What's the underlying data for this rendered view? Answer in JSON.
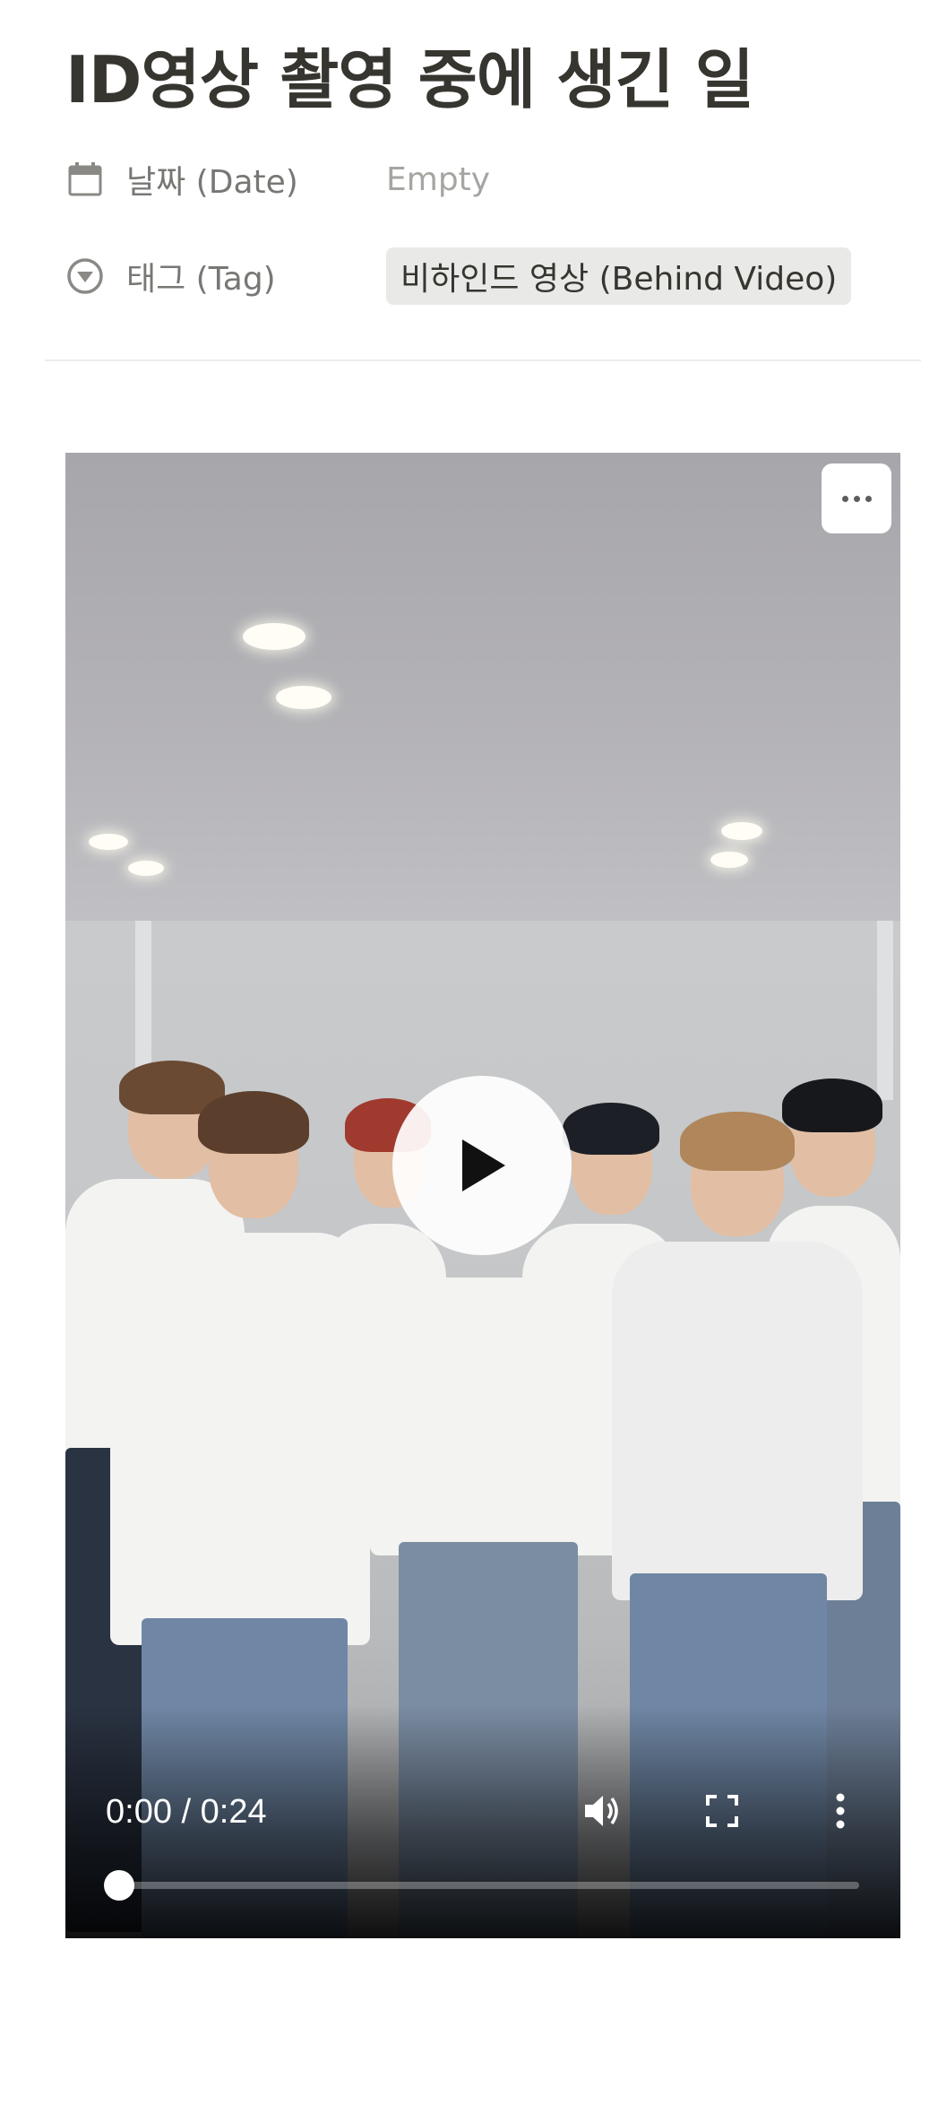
{
  "page": {
    "title": "ID영상 촬영 중에 생긴 일"
  },
  "properties": {
    "date": {
      "label": "날짜 (Date)",
      "value": "Empty",
      "icon": "calendar-icon"
    },
    "tag": {
      "label": "태그 (Tag)",
      "value": "비하인드 영상 (Behind Video)",
      "icon": "select-circle-icon"
    }
  },
  "video": {
    "current_time": "0:00",
    "duration": "0:24",
    "time_display": "0:00 / 0:24",
    "progress": 0,
    "icons": {
      "more": "more-horizontal-icon",
      "play": "play-icon",
      "volume": "volume-icon",
      "fullscreen": "fullscreen-icon",
      "options": "more-vertical-icon"
    }
  },
  "colors": {
    "text": "#37352f",
    "muted": "#787774",
    "placeholder": "#a6a5a2",
    "tag_bg": "#e9e9e7"
  }
}
